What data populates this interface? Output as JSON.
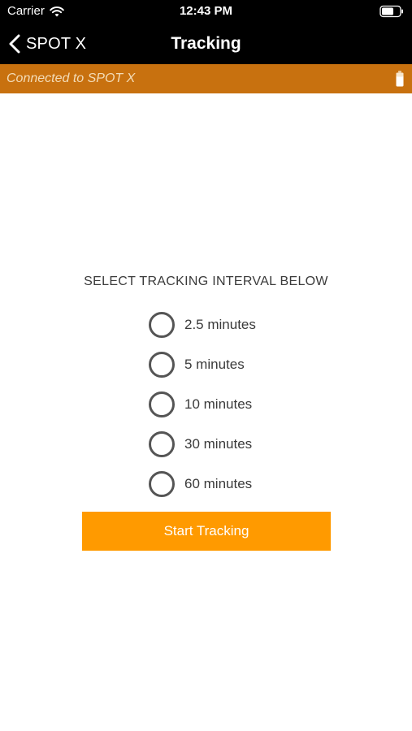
{
  "status_bar": {
    "carrier": "Carrier",
    "time": "12:43 PM",
    "wifi_icon": "wifi-icon",
    "battery_icon": "battery-icon"
  },
  "nav": {
    "back_label": "SPOT X",
    "back_icon": "chevron-left-icon",
    "title": "Tracking"
  },
  "banner": {
    "text": "Connected to SPOT X",
    "icon": "device-battery-icon",
    "color": "#c8710f"
  },
  "tracking": {
    "heading": "SELECT TRACKING INTERVAL BELOW",
    "options": [
      {
        "label": "2.5 minutes"
      },
      {
        "label": "5 minutes"
      },
      {
        "label": "10 minutes"
      },
      {
        "label": "30 minutes"
      },
      {
        "label": "60 minutes"
      }
    ],
    "start_label": "Start Tracking",
    "accent_color": "#ff9a00"
  }
}
